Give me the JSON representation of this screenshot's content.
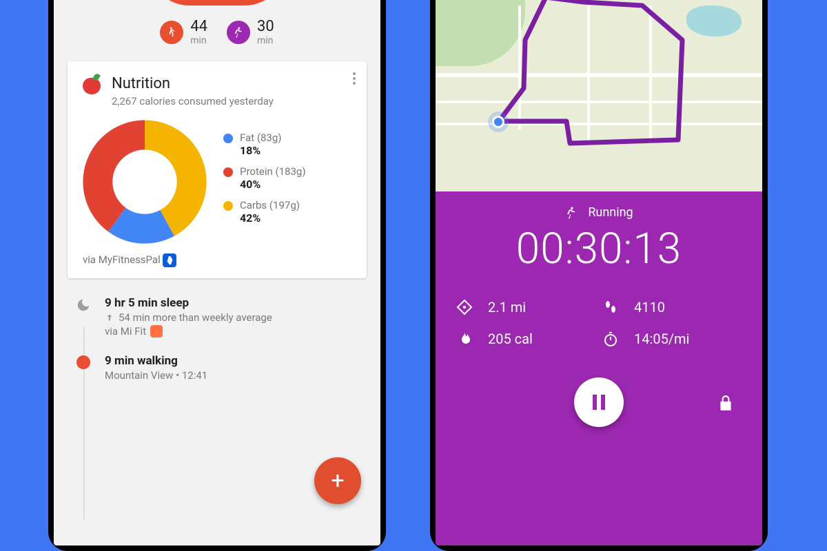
{
  "colors": {
    "orange": "#e84e2f",
    "purple": "#9c27b0",
    "blue": "#4285f4",
    "red": "#e14232",
    "yellow": "#f4b400"
  },
  "left": {
    "chips": {
      "walking": {
        "value": "44",
        "unit": "min"
      },
      "running": {
        "value": "30",
        "unit": "min"
      }
    },
    "nutrition": {
      "title": "Nutrition",
      "subtitle": "2,267 calories consumed yesterday",
      "via": "via MyFitnessPal",
      "legend": {
        "fat": {
          "label": "Fat (83g)",
          "pct": "18%"
        },
        "protein": {
          "label": "Protein (183g)",
          "pct": "40%"
        },
        "carbs": {
          "label": "Carbs (197g)",
          "pct": "42%"
        }
      }
    },
    "timeline": {
      "sleep": {
        "title": "9 hr 5 min sleep",
        "delta": "54 min more than weekly average",
        "via": "via Mi Fit"
      },
      "walking": {
        "title": "9 min walking",
        "sub": "Mountain View • 12:41"
      }
    }
  },
  "right": {
    "activity": "Running",
    "timer": "00:30:13",
    "stats": {
      "distance": "2.1 mi",
      "steps": "4110",
      "calories": "205 cal",
      "pace": "14:05/mi"
    }
  },
  "chart_data": {
    "type": "pie",
    "title": "Nutrition",
    "series": [
      {
        "name": "Fat",
        "grams": 83,
        "pct": 18,
        "color": "#4285f4"
      },
      {
        "name": "Protein",
        "grams": 183,
        "pct": 40,
        "color": "#e14232"
      },
      {
        "name": "Carbs",
        "grams": 197,
        "pct": 42,
        "color": "#f4b400"
      }
    ]
  }
}
